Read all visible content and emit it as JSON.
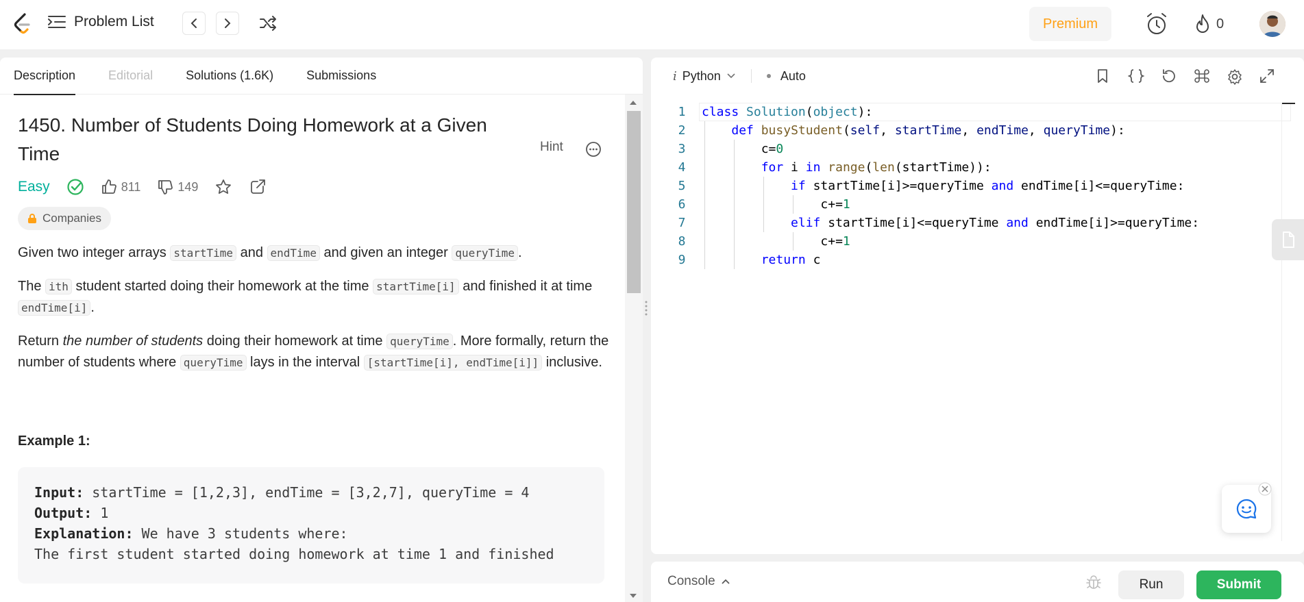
{
  "header": {
    "problem_list_label": "Problem List",
    "premium_label": "Premium",
    "streak_count": "0"
  },
  "tabs": [
    {
      "label": "Description"
    },
    {
      "label": "Editorial"
    },
    {
      "label": "Solutions (1.6K)"
    },
    {
      "label": "Submissions"
    }
  ],
  "problem": {
    "title": "1450. Number of Students Doing Homework at a Given Time",
    "hint_label": "Hint",
    "difficulty": "Easy",
    "likes": "811",
    "dislikes": "149",
    "companies_label": "Companies"
  },
  "description": {
    "p1": {
      "a": "Given two integer arrays ",
      "c1": "startTime",
      "b": " and ",
      "c2": "endTime",
      "d": " and given an integer ",
      "c3": "queryTime",
      "e": "."
    },
    "p2": {
      "a": "The ",
      "c1": "ith",
      "b": " student started doing their homework at the time ",
      "c2": "startTime[i]",
      "d": " and finished it at time ",
      "c3": "endTime[i]",
      "e": "."
    },
    "p3": {
      "a": "Return ",
      "em": "the number of students",
      "b": " doing their homework at time ",
      "c1": "queryTime",
      "d": ". More formally, return the number of students where ",
      "c2": "queryTime",
      "e": " lays in the interval ",
      "c3": "[startTime[i], endTime[i]]",
      "f": " inclusive."
    }
  },
  "example1": {
    "heading": "Example 1:",
    "input_label": "Input:",
    "input_value": " startTime = [1,2,3], endTime = [3,2,7], queryTime = 4",
    "output_label": "Output:",
    "output_value": " 1",
    "explanation_label": "Explanation:",
    "explanation_value": " We have 3 students where:",
    "next_line": "The first student started doing homework at time 1 and finished"
  },
  "editor": {
    "language": "Python",
    "mode": "Auto",
    "line_numbers": [
      "1",
      "2",
      "3",
      "4",
      "5",
      "6",
      "7",
      "8",
      "9"
    ]
  },
  "bottom": {
    "console_label": "Console",
    "run_label": "Run",
    "submit_label": "Submit"
  },
  "colors": {
    "accent_premium": "#ffa116",
    "easy": "#00af9b",
    "submit": "#2db55d"
  }
}
